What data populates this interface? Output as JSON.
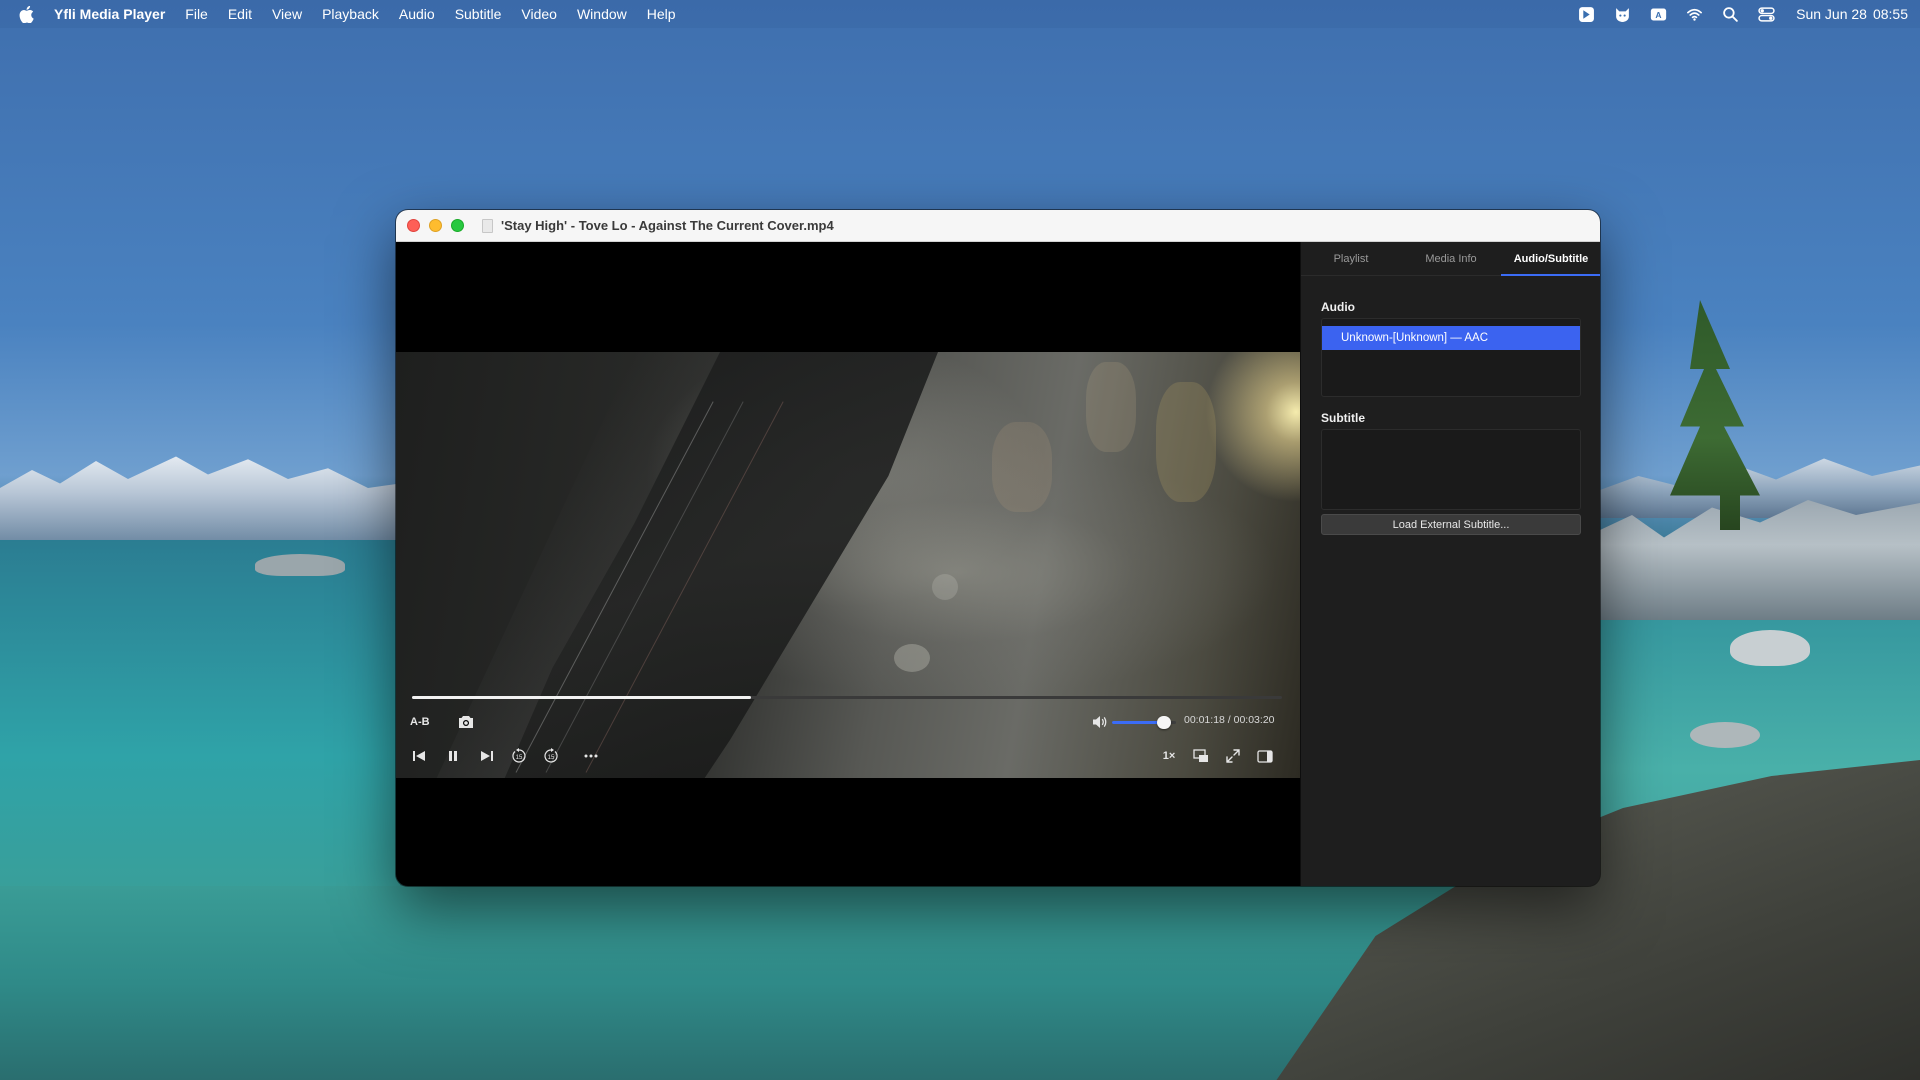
{
  "menubar": {
    "app_name": "Yfli Media Player",
    "menus": [
      "File",
      "Edit",
      "View",
      "Playback",
      "Audio",
      "Subtitle",
      "Video",
      "Window",
      "Help"
    ],
    "clock_date": "Sun Jun 28",
    "clock_time": "08:55"
  },
  "window": {
    "title": "'Stay High' - Tove Lo - Against The Current Cover.mp4"
  },
  "controls": {
    "ab_label": "A-B",
    "speed_label": "1×",
    "time_readout": "00:01:18 / 00:03:20",
    "progress_fraction": 0.39,
    "volume_fraction": 0.82
  },
  "panel": {
    "tabs": [
      "Playlist",
      "Media Info",
      "Audio/Subtitle"
    ],
    "active_tab": "Audio/Subtitle",
    "audio_title": "Audio",
    "audio_tracks": [
      "Unknown-[Unknown] — AAC"
    ],
    "subtitle_title": "Subtitle",
    "load_button_label": "Load External Subtitle..."
  },
  "colors": {
    "accent": "#3b6cf6",
    "selection": "#3b63f0"
  }
}
